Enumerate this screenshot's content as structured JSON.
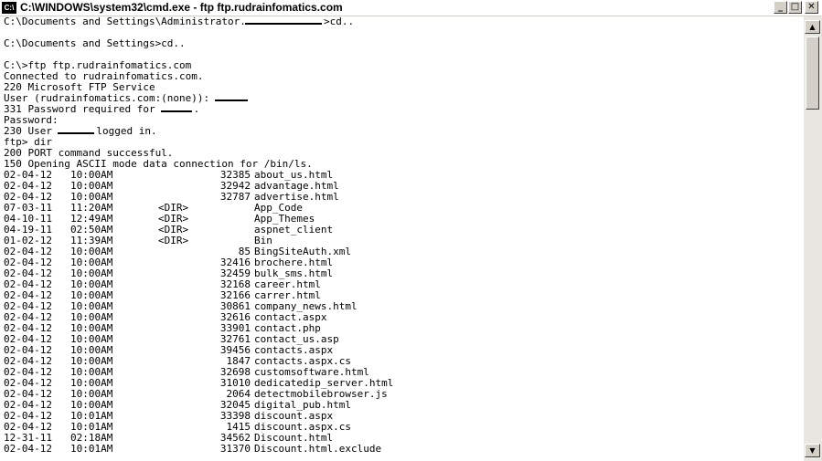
{
  "window": {
    "title": "C:\\WINDOWS\\system32\\cmd.exe - ftp ftp.rudrainfomatics.com",
    "icon": "C:\\",
    "controls": {
      "minimize": "_",
      "maximize": "□",
      "close": "✕"
    }
  },
  "console": {
    "intro": [
      {
        "pre": "C:\\Documents and Settings\\Administrator.",
        "redact": true,
        "post": ">cd.."
      },
      {
        "pre": ""
      },
      {
        "pre": "C:\\Documents and Settings>cd.."
      },
      {
        "pre": ""
      },
      {
        "pre": "C:\\>ftp ftp.rudrainfomatics.com"
      },
      {
        "pre": "Connected to rudrainfomatics.com."
      },
      {
        "pre": "220 Microsoft FTP Service"
      },
      {
        "pre": "User (rudrainfomatics.com:(none)): ",
        "redact": true,
        "post": ""
      },
      {
        "pre": "331 Password required for ",
        "redact": true,
        "post": "."
      },
      {
        "pre": "Password:"
      },
      {
        "pre": "230 User ",
        "redact": true,
        "post": "logged in."
      },
      {
        "pre": "ftp> dir"
      },
      {
        "pre": "200 PORT command successful."
      },
      {
        "pre": "150 Opening ASCII mode data connection for /bin/ls."
      }
    ],
    "listing": [
      {
        "date": "02-04-12",
        "time": "10:00AM",
        "dir": "",
        "size": "32385",
        "name": "about_us.html"
      },
      {
        "date": "02-04-12",
        "time": "10:00AM",
        "dir": "",
        "size": "32942",
        "name": "advantage.html"
      },
      {
        "date": "02-04-12",
        "time": "10:00AM",
        "dir": "",
        "size": "32787",
        "name": "advertise.html"
      },
      {
        "date": "07-03-11",
        "time": "11:20AM",
        "dir": "<DIR>",
        "size": "",
        "name": "App_Code"
      },
      {
        "date": "04-10-11",
        "time": "12:49AM",
        "dir": "<DIR>",
        "size": "",
        "name": "App_Themes"
      },
      {
        "date": "04-19-11",
        "time": "02:50AM",
        "dir": "<DIR>",
        "size": "",
        "name": "aspnet_client"
      },
      {
        "date": "01-02-12",
        "time": "11:39AM",
        "dir": "<DIR>",
        "size": "",
        "name": "Bin"
      },
      {
        "date": "02-04-12",
        "time": "10:00AM",
        "dir": "",
        "size": "85",
        "name": "BingSiteAuth.xml"
      },
      {
        "date": "02-04-12",
        "time": "10:00AM",
        "dir": "",
        "size": "32416",
        "name": "brochere.html"
      },
      {
        "date": "02-04-12",
        "time": "10:00AM",
        "dir": "",
        "size": "32459",
        "name": "bulk_sms.html"
      },
      {
        "date": "02-04-12",
        "time": "10:00AM",
        "dir": "",
        "size": "32168",
        "name": "career.html"
      },
      {
        "date": "02-04-12",
        "time": "10:00AM",
        "dir": "",
        "size": "32166",
        "name": "carrer.html"
      },
      {
        "date": "02-04-12",
        "time": "10:00AM",
        "dir": "",
        "size": "30861",
        "name": "company_news.html"
      },
      {
        "date": "02-04-12",
        "time": "10:00AM",
        "dir": "",
        "size": "32616",
        "name": "contact.aspx"
      },
      {
        "date": "02-04-12",
        "time": "10:00AM",
        "dir": "",
        "size": "33901",
        "name": "contact.php"
      },
      {
        "date": "02-04-12",
        "time": "10:00AM",
        "dir": "",
        "size": "32761",
        "name": "contact_us.asp"
      },
      {
        "date": "02-04-12",
        "time": "10:00AM",
        "dir": "",
        "size": "39456",
        "name": "contacts.aspx"
      },
      {
        "date": "02-04-12",
        "time": "10:00AM",
        "dir": "",
        "size": "1847",
        "name": "contacts.aspx.cs"
      },
      {
        "date": "02-04-12",
        "time": "10:00AM",
        "dir": "",
        "size": "32698",
        "name": "customsoftware.html"
      },
      {
        "date": "02-04-12",
        "time": "10:00AM",
        "dir": "",
        "size": "31010",
        "name": "dedicatedip_server.html"
      },
      {
        "date": "02-04-12",
        "time": "10:00AM",
        "dir": "",
        "size": "2064",
        "name": "detectmobilebrowser.js"
      },
      {
        "date": "02-04-12",
        "time": "10:00AM",
        "dir": "",
        "size": "32045",
        "name": "digital_pub.html"
      },
      {
        "date": "02-04-12",
        "time": "10:01AM",
        "dir": "",
        "size": "33398",
        "name": "discount.aspx"
      },
      {
        "date": "02-04-12",
        "time": "10:01AM",
        "dir": "",
        "size": "1415",
        "name": "discount.aspx.cs"
      },
      {
        "date": "12-31-11",
        "time": "02:18AM",
        "dir": "",
        "size": "34562",
        "name": "Discount.html"
      },
      {
        "date": "02-04-12",
        "time": "10:01AM",
        "dir": "",
        "size": "31370",
        "name": "Discount.html.exclude"
      }
    ]
  },
  "scrollbar": {
    "up": "▲",
    "down": "▼"
  }
}
